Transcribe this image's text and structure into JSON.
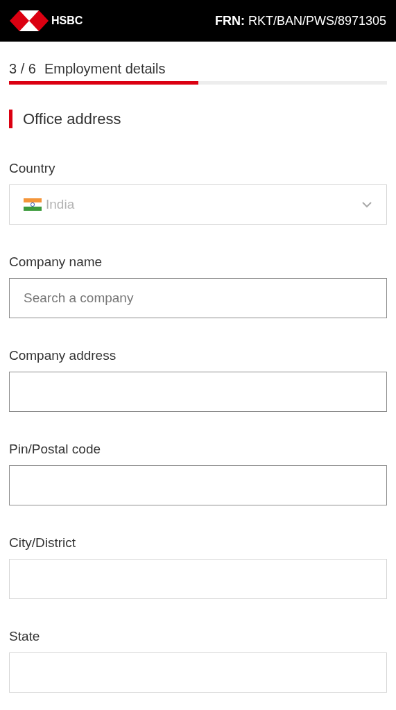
{
  "header": {
    "brand": "HSBC",
    "reference": "**FRN:** RKT/BAN/PWS/8971305"
  },
  "progress": {
    "step": "3 / 6",
    "title": "Employment details",
    "level": 0.5
  },
  "section": {
    "title": "Office address"
  },
  "fields": [
    {
      "label": "Country",
      "kind": "select",
      "value": "India",
      "disabled": true
    },
    {
      "label": "Company name",
      "kind": "text",
      "placeholder": "Search a company",
      "disabled": false
    },
    {
      "label": "Company address",
      "kind": "text",
      "disabled": false
    },
    {
      "label": "Pin/Postal code",
      "kind": "text",
      "disabled": false
    },
    {
      "label": "City/District",
      "kind": "text",
      "disabled": true
    },
    {
      "label": "State",
      "kind": "text",
      "disabled": true
    }
  ]
}
